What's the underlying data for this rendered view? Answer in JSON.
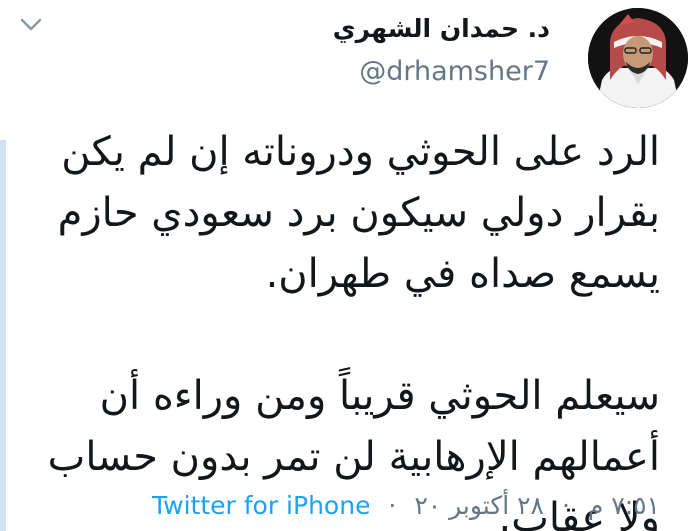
{
  "author": {
    "name": "د. حمدان الشهري",
    "handle": "@drhamsher7"
  },
  "tweet": {
    "paragraphs": [
      "الرد على الحوثي ودروناته إن لم يكن بقرار دولي سيكون برد سعودي حازم يسمع صداه في طهران.",
      "سيعلم الحوثي قريباً ومن وراءه أن أعمالهم الإرهابية لن تمر بدون حساب ولا عقاب."
    ]
  },
  "meta": {
    "time": "٧:٥١ م",
    "date": "٢٨ أكتوبر ٢٠",
    "separator": "·",
    "source": "Twitter for iPhone"
  },
  "icons": {
    "menu": "chevron-down-icon"
  },
  "colors": {
    "text": "#14171a",
    "secondary": "#657786",
    "link": "#1da1f2",
    "edge": "#cfe3f5"
  }
}
